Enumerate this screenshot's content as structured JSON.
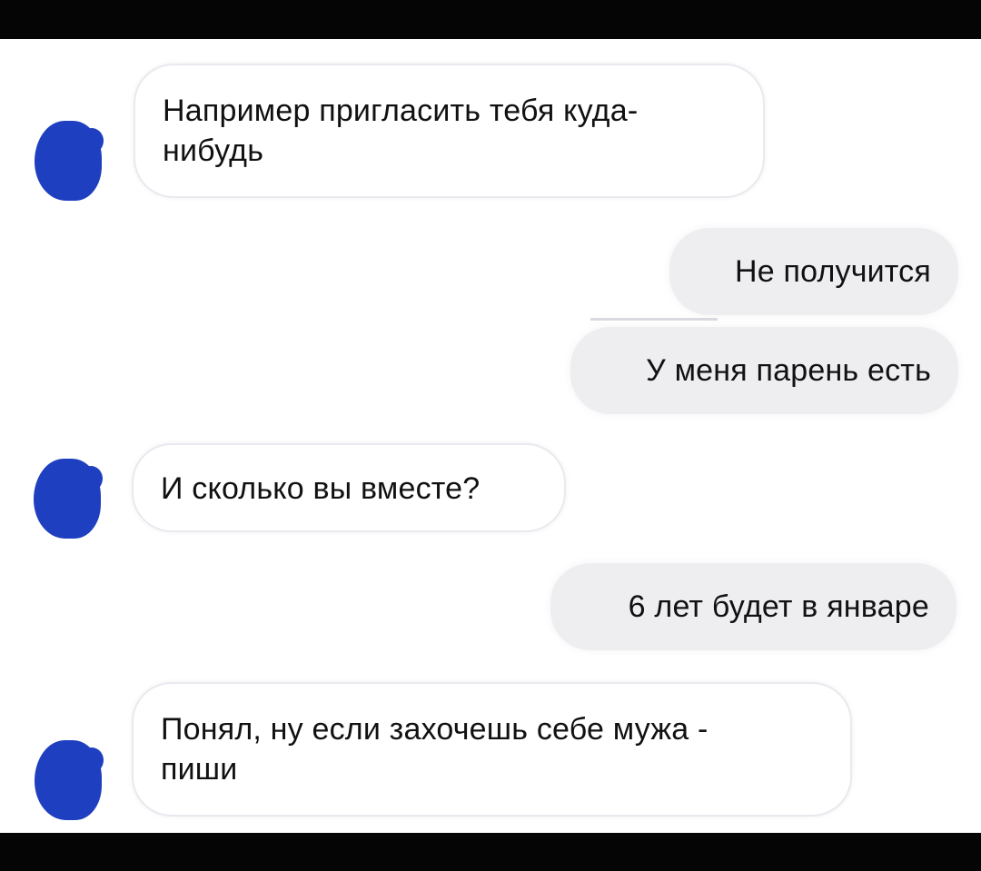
{
  "messages": [
    {
      "side": "incoming",
      "text": "Например пригласить тебя куда-\nнибудь"
    },
    {
      "side": "outgoing",
      "text": "Не получится"
    },
    {
      "side": "outgoing",
      "text": "У меня парень есть"
    },
    {
      "side": "incoming",
      "text": "И сколько вы вместе?"
    },
    {
      "side": "outgoing",
      "text": "6 лет будет в январе"
    },
    {
      "side": "incoming",
      "text": "Понял, ну если захочешь себе мужа -\nпиши"
    }
  ],
  "colors": {
    "avatar": "#1e3fbf",
    "incoming_bubble": "#ffffff",
    "outgoing_bubble": "#eeeef1",
    "frame": "#050505"
  }
}
